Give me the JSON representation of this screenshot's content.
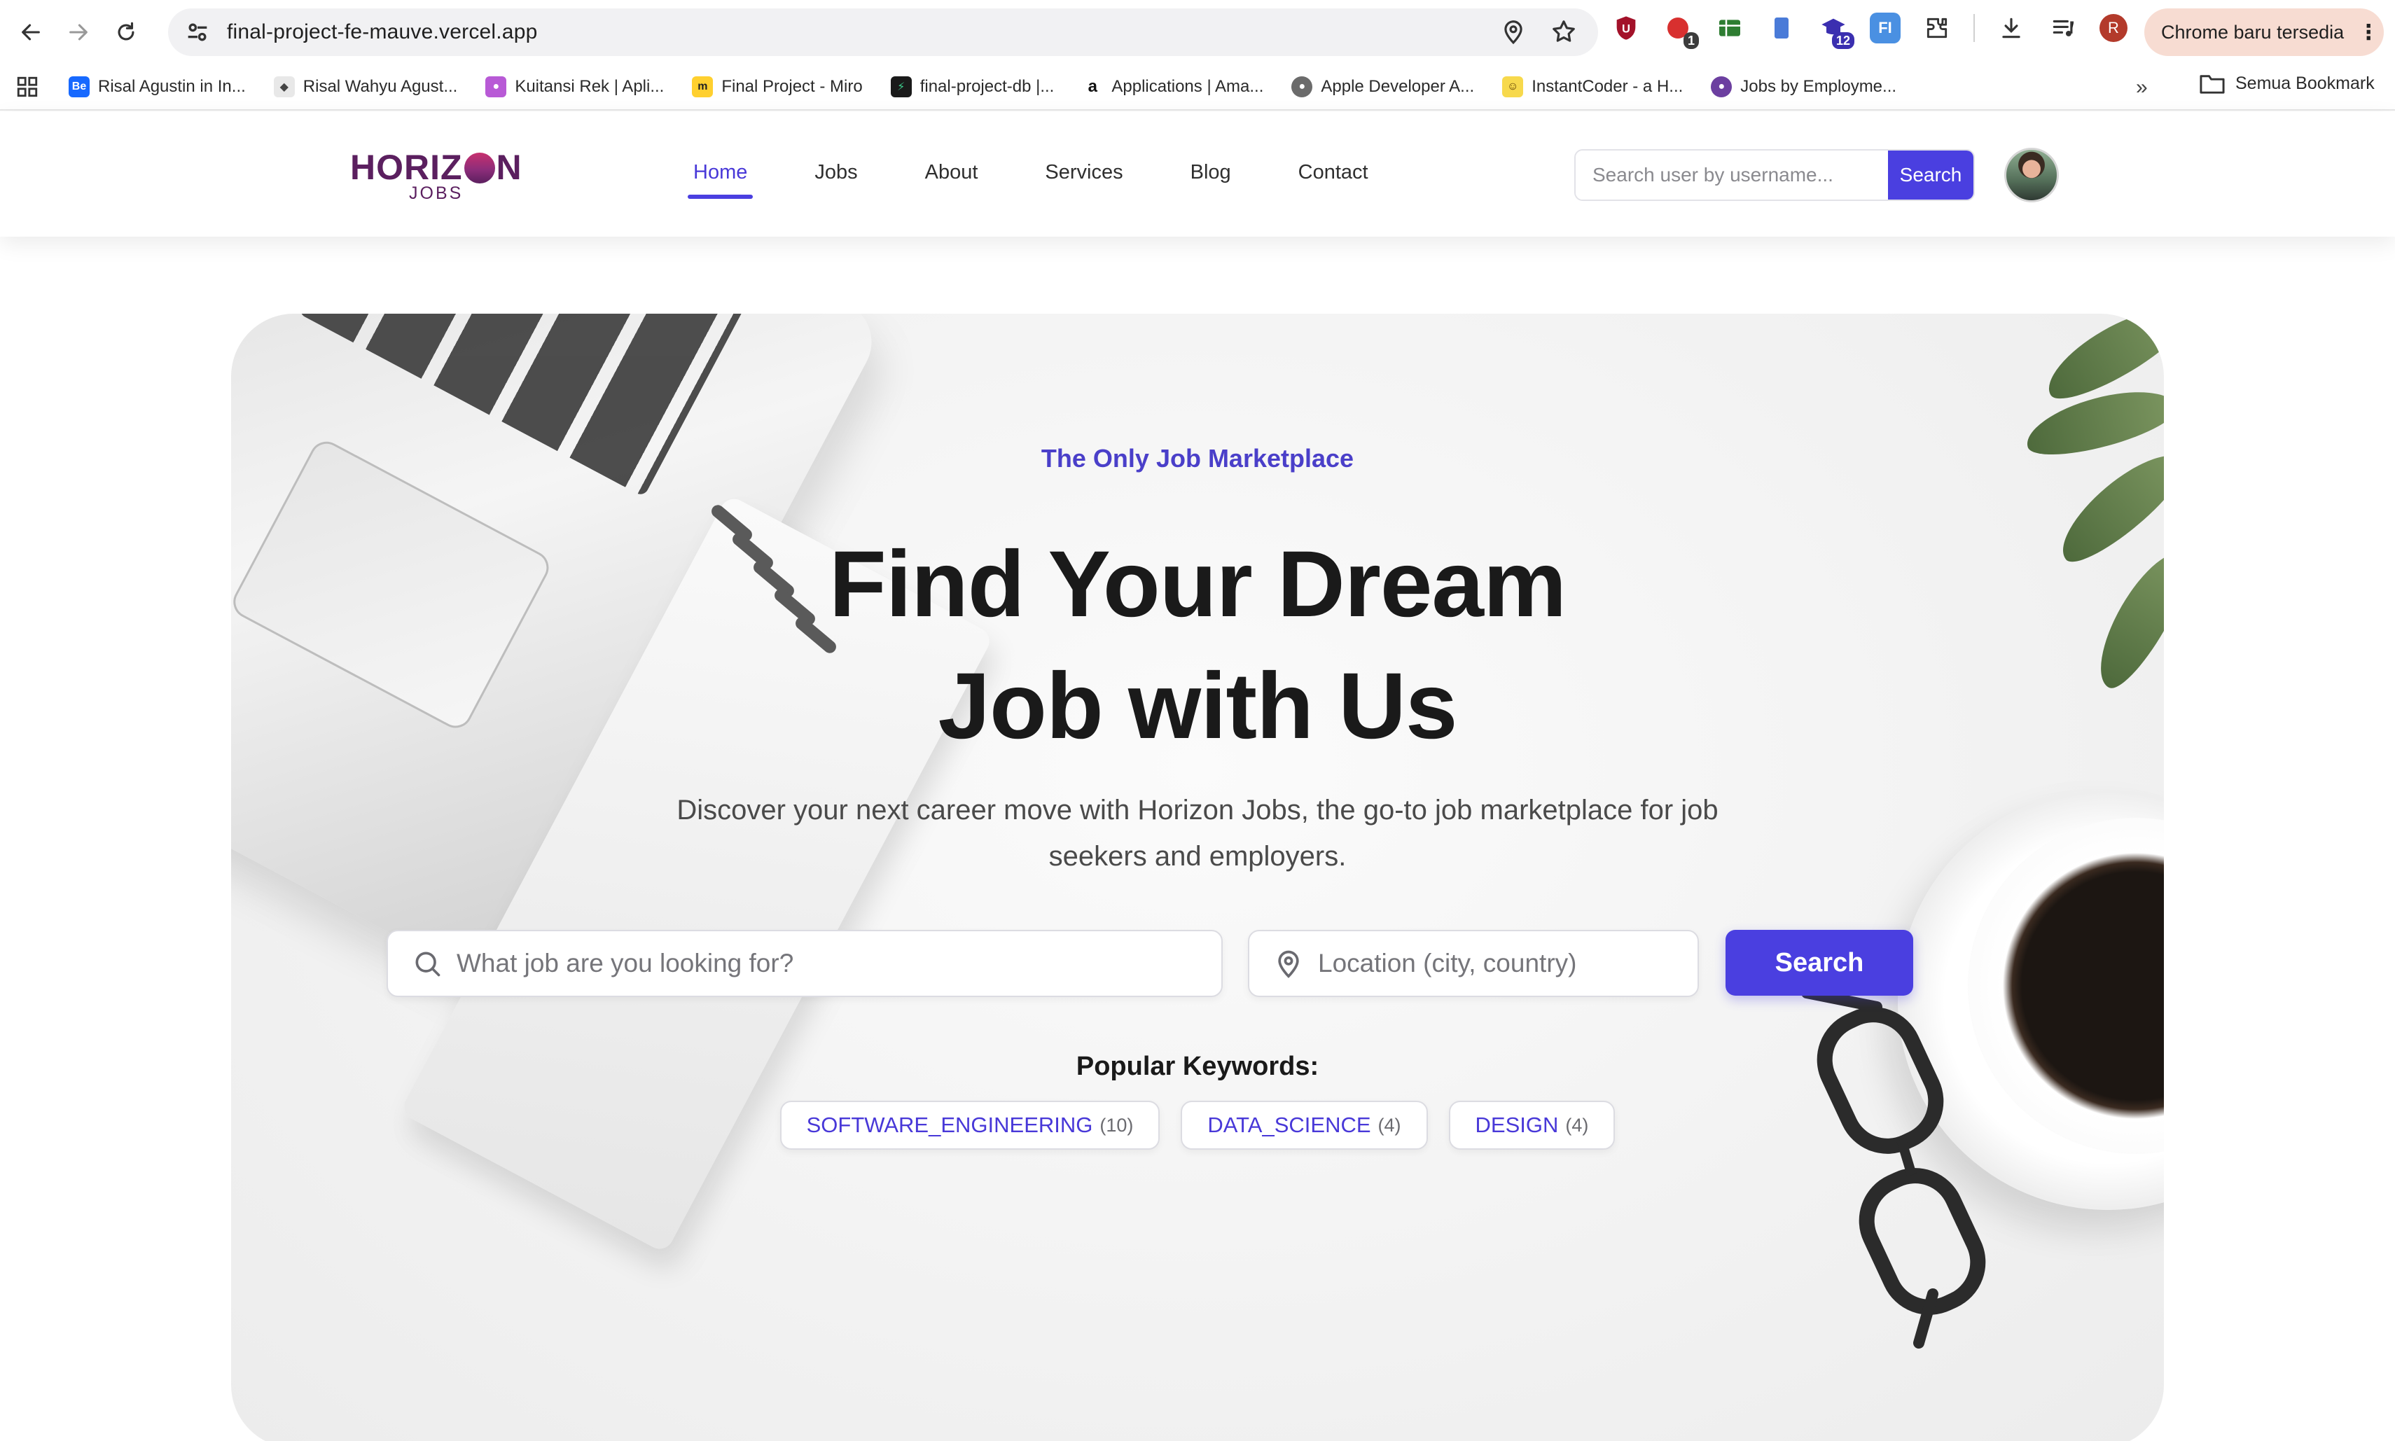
{
  "browser": {
    "url": "final-project-fe-mauve.vercel.app",
    "profile_initial": "R",
    "update_label": "Chrome baru tersedia",
    "extension_badges": {
      "ext2": "1",
      "ext5": "12"
    },
    "bookmarks": [
      {
        "label": "Risal Agustin in In...",
        "color": "#1769ff",
        "glyph": "Be"
      },
      {
        "label": "Risal Wahyu Agust...",
        "color": "#e8e8e8",
        "glyph": "◆"
      },
      {
        "label": "Kuitansi Rek | Apli...",
        "color": "#b85ad6",
        "glyph": "●"
      },
      {
        "label": "Final Project - Miro",
        "color": "#ffd02f",
        "glyph": "m"
      },
      {
        "label": "final-project-db |...",
        "color": "#1a1a1a",
        "glyph": "⚡"
      },
      {
        "label": "Applications | Ama...",
        "color": "#ffffff",
        "glyph": "a"
      },
      {
        "label": "Apple Developer A...",
        "color": "#6b6b6b",
        "glyph": "●"
      },
      {
        "label": "InstantCoder - a H...",
        "color": "#f7d94c",
        "glyph": "☺"
      },
      {
        "label": "Jobs by Employme...",
        "color": "#6c3fa0",
        "glyph": "●"
      }
    ],
    "all_bookmarks_label": "Semua Bookmark"
  },
  "site": {
    "logo": {
      "word_left": "HORIZ",
      "word_right": "N",
      "sub": "JOBS"
    },
    "nav": [
      "Home",
      "Jobs",
      "About",
      "Services",
      "Blog",
      "Contact"
    ],
    "active_nav": "Home",
    "user_search": {
      "placeholder": "Search user by username...",
      "button": "Search"
    }
  },
  "hero": {
    "eyebrow": "The Only Job Marketplace",
    "headline_line1": "Find Your Dream",
    "headline_line2": "Job with Us",
    "subtitle": "Discover your next career move with Horizon Jobs, the go-to job marketplace for job seekers and employers.",
    "job_placeholder": "What job are you looking for?",
    "location_placeholder": "Location (city, country)",
    "search_button": "Search",
    "popular_title": "Popular Keywords:",
    "keywords": [
      {
        "keyword": "SOFTWARE_ENGINEERING",
        "count": "(10)"
      },
      {
        "keyword": "DATA_SCIENCE",
        "count": "(4)"
      },
      {
        "keyword": "DESIGN",
        "count": "(4)"
      }
    ]
  },
  "colors": {
    "accent": "#4a3fe0",
    "brand": "#5b1f5f",
    "eyebrow": "#4a3fc9"
  }
}
